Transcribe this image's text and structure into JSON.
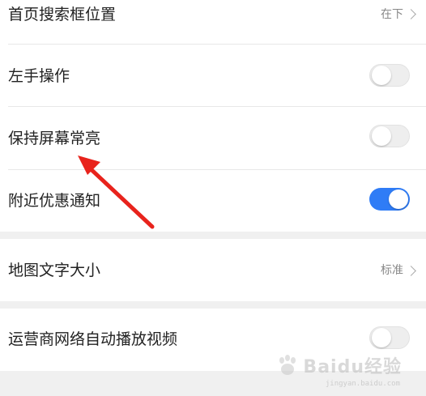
{
  "group1": {
    "rows": [
      {
        "label": "首页搜索框位置",
        "value": "在下"
      },
      {
        "label": "左手操作",
        "toggle": "off"
      },
      {
        "label": "保持屏幕常亮",
        "toggle": "off"
      },
      {
        "label": "附近优惠通知",
        "toggle": "on"
      }
    ]
  },
  "group2": {
    "rows": [
      {
        "label": "地图文字大小",
        "value": "标准"
      }
    ]
  },
  "group3": {
    "rows": [
      {
        "label": "运营商网络自动播放视频",
        "toggle": "off"
      }
    ]
  },
  "colors": {
    "toggle_on": "#2f7cf6",
    "arrow": "#e8231c"
  },
  "watermark": {
    "text": "Baidu经验",
    "sub": "jingyan.baidu.com"
  }
}
